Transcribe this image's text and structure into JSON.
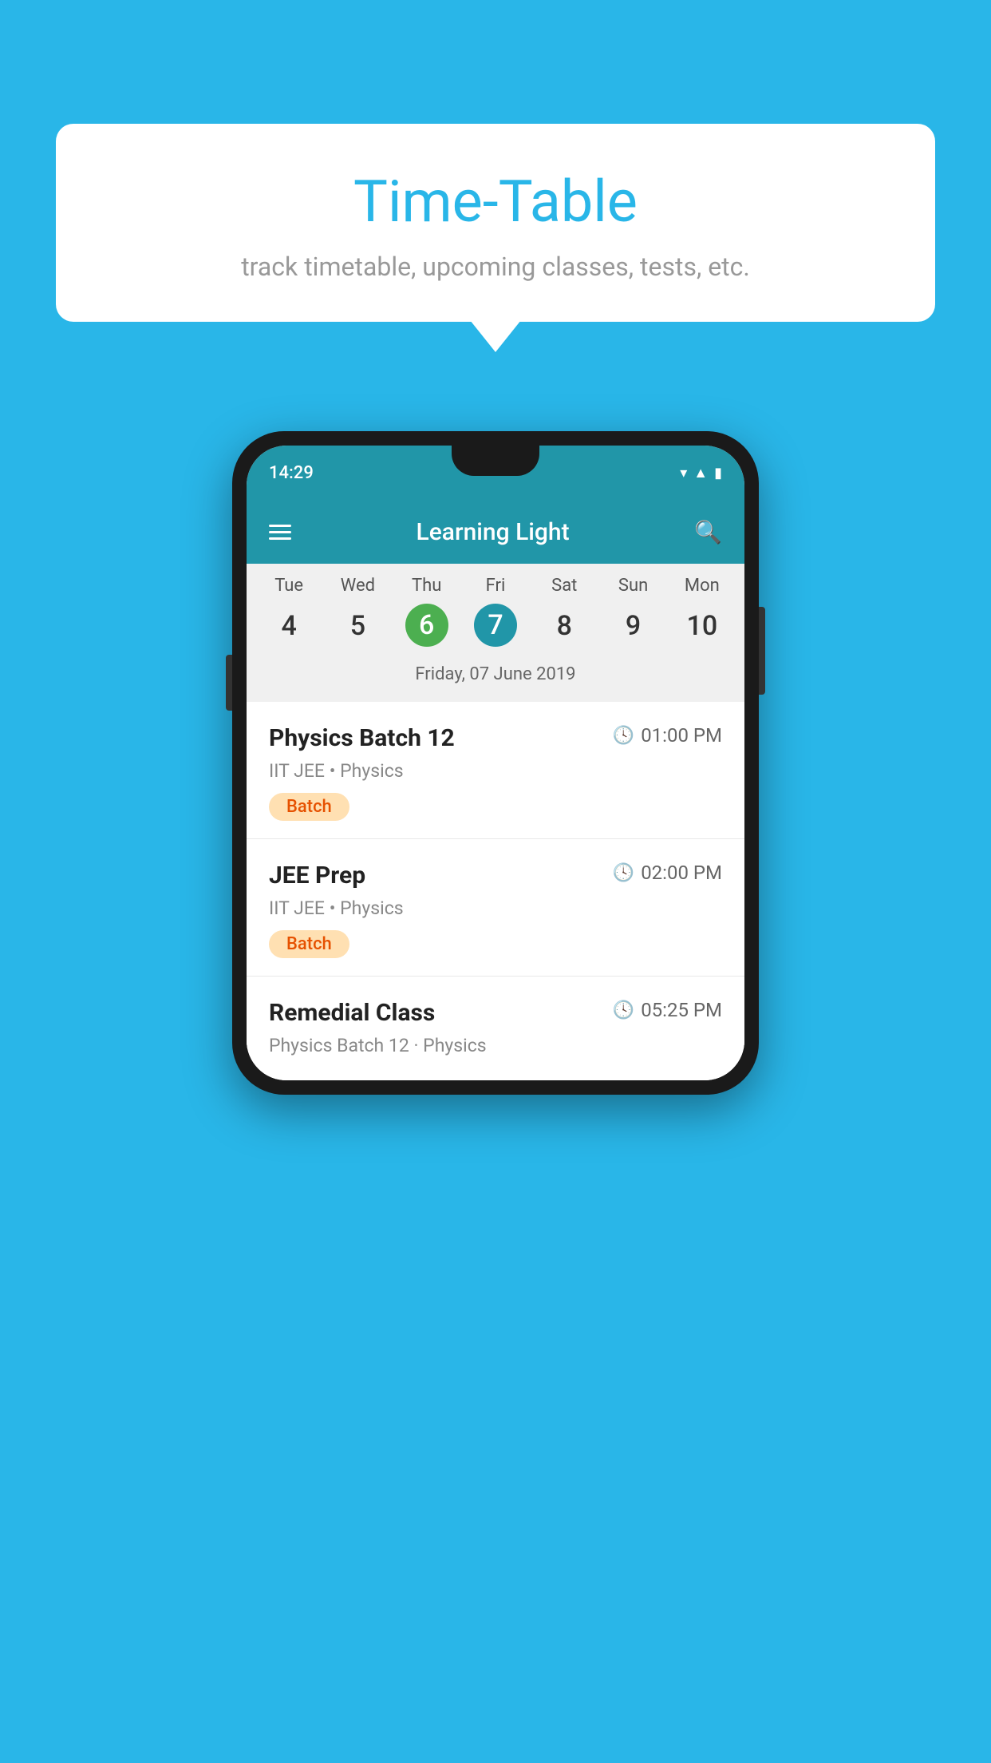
{
  "background_color": "#29b6e8",
  "bubble": {
    "title": "Time-Table",
    "subtitle": "track timetable, upcoming classes, tests, etc."
  },
  "phone": {
    "status_time": "14:29",
    "app_title": "Learning Light",
    "calendar": {
      "days_of_week": [
        "Tue",
        "Wed",
        "Thu",
        "Fri",
        "Sat",
        "Sun",
        "Mon"
      ],
      "dates": [
        "4",
        "5",
        "6",
        "7",
        "8",
        "9",
        "10"
      ],
      "today_index": 2,
      "selected_index": 3,
      "selected_date_label": "Friday, 07 June 2019"
    },
    "schedule": [
      {
        "title": "Physics Batch 12",
        "time": "01:00 PM",
        "subtitle": "IIT JEE • Physics",
        "badge": "Batch"
      },
      {
        "title": "JEE Prep",
        "time": "02:00 PM",
        "subtitle": "IIT JEE • Physics",
        "badge": "Batch"
      },
      {
        "title": "Remedial Class",
        "time": "05:25 PM",
        "subtitle": "Physics Batch 12 · Physics",
        "badge": null
      }
    ]
  },
  "icons": {
    "menu": "☰",
    "search": "🔍",
    "clock": "🕐"
  }
}
